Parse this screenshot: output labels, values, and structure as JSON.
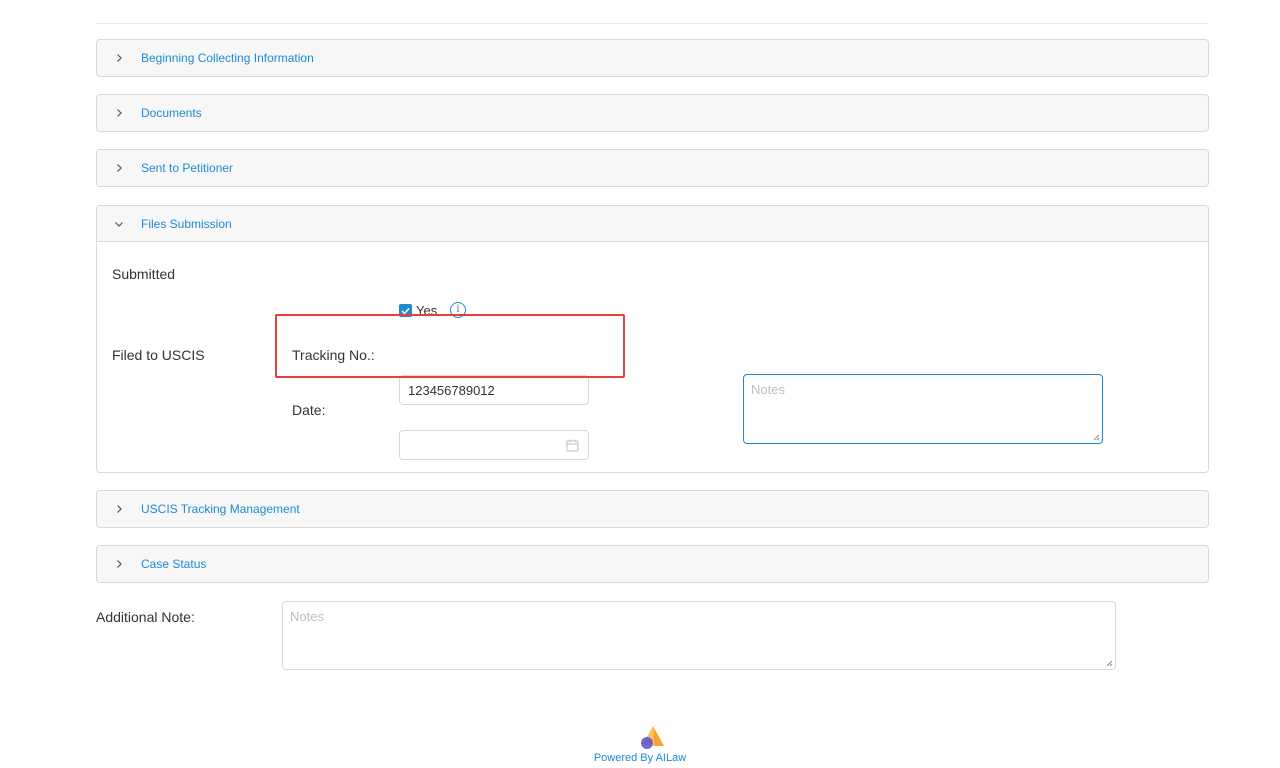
{
  "accent_color": "#1f8ad2",
  "highlight_color": "#e5403c",
  "panels": [
    {
      "title": "Beginning Collecting Information",
      "expanded": false
    },
    {
      "title": "Documents",
      "expanded": false
    },
    {
      "title": "Sent to Petitioner",
      "expanded": false
    },
    {
      "title": "Files Submission",
      "expanded": true
    },
    {
      "title": "USCIS Tracking Management",
      "expanded": false
    },
    {
      "title": "Case Status",
      "expanded": false
    }
  ],
  "files_submission": {
    "submitted_label": "Submitted",
    "submitted_checked": true,
    "yes_label": "Yes",
    "info_icon": "info-icon",
    "filed_label": "Filed to USCIS",
    "tracking_label": "Tracking No.:",
    "tracking_value": "123456789012",
    "date_label": "Date:",
    "date_value": "",
    "notes_placeholder": "Notes"
  },
  "additional_note": {
    "label": "Additional Note:",
    "placeholder": "Notes"
  },
  "footer": {
    "powered_by": "Powered By AILaw"
  }
}
